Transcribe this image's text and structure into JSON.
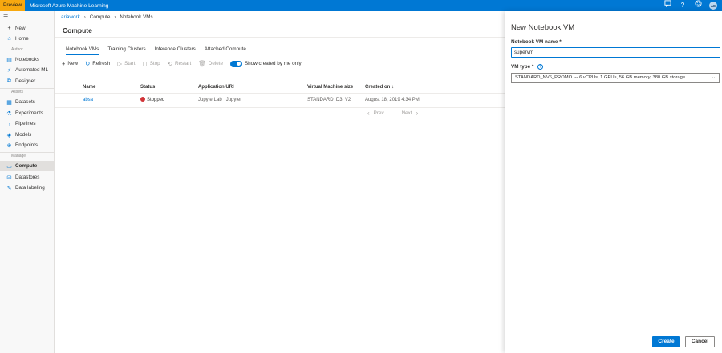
{
  "topbar": {
    "preview_label": "Preview",
    "app_title": "Microsoft Azure Machine Learning",
    "icons": [
      "feedback-icon",
      "help-icon",
      "smiley-icon"
    ],
    "help_glyph": "?",
    "avatar_initials": "AE"
  },
  "sidebar": {
    "items": [
      {
        "label": "New",
        "icon": "plus-icon"
      },
      {
        "label": "Home",
        "icon": "home-icon"
      },
      {
        "label": "Notebooks",
        "icon": "notebook-icon"
      },
      {
        "label": "Automated ML",
        "icon": "automl-icon"
      },
      {
        "label": "Designer",
        "icon": "designer-icon"
      },
      {
        "label": "Datasets",
        "icon": "datasets-icon"
      },
      {
        "label": "Experiments",
        "icon": "experiments-icon"
      },
      {
        "label": "Pipelines",
        "icon": "pipelines-icon"
      },
      {
        "label": "Models",
        "icon": "models-icon"
      },
      {
        "label": "Endpoints",
        "icon": "endpoints-icon"
      },
      {
        "label": "Compute",
        "icon": "compute-icon"
      },
      {
        "label": "Datastores",
        "icon": "datastores-icon"
      },
      {
        "label": "Data labeling",
        "icon": "data-labeling-icon"
      }
    ],
    "sections": {
      "author": "Author",
      "assets": "Assets",
      "manage": "Manage"
    },
    "active": "Compute"
  },
  "breadcrumb": {
    "workspace": "ariawork",
    "compute": "Compute",
    "current": "Notebook VMs"
  },
  "main": {
    "title": "Compute",
    "tabs": [
      "Notebook VMs",
      "Training Clusters",
      "Inference Clusters",
      "Attached Compute"
    ],
    "active_tab": "Notebook VMs",
    "toolbar": {
      "new": "New",
      "refresh": "Refresh",
      "start": "Start",
      "stop": "Stop",
      "restart": "Restart",
      "delete": "Delete",
      "toggle_label": "Show created by me only"
    },
    "table": {
      "headers": [
        "Name",
        "Status",
        "Application URI",
        "Virtual Machine size",
        "Created on"
      ],
      "sort_glyph": "↓",
      "rows": [
        {
          "name": "absa",
          "status": "Stopped",
          "uri": "JupyterLab   Jupyter",
          "size": "STANDARD_D3_V2",
          "created": "August 18, 2019 4:34 PM"
        }
      ]
    },
    "pager": {
      "prev": "Prev",
      "next": "Next"
    }
  },
  "panel": {
    "title": "New Notebook VM",
    "name_label": "Notebook VM name",
    "required_mark": "*",
    "name_value": "supervm",
    "type_label": "VM type",
    "info_glyph": "?",
    "type_value": "STANDARD_NV6_PROMO --- 6 vCPUs, 1 GPUs, 56 GB memory, 380 GB storage",
    "create_label": "Create",
    "cancel_label": "Cancel"
  },
  "colors": {
    "accent": "#0078d4",
    "preview_badge": "#f7a80f",
    "status_stopped": "#d13438"
  }
}
